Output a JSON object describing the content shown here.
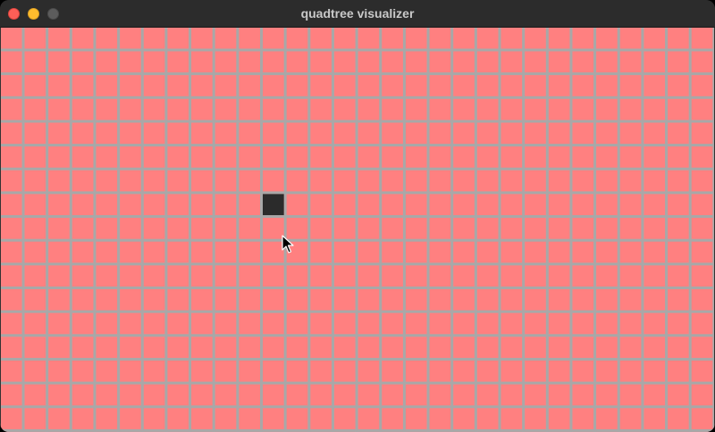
{
  "window": {
    "title": "quadtree visualizer"
  },
  "titlebar": {
    "buttons": [
      {
        "name": "close-button",
        "color": "#fe5f57"
      },
      {
        "name": "minimize-button",
        "color": "#febc2e"
      },
      {
        "name": "zoom-button",
        "color": "#5c5c5c"
      }
    ]
  },
  "canvas": {
    "background_color": "#ff8080",
    "grid_line_color": "#a8a8a8",
    "grid_columns": 30,
    "grid_rows": 17,
    "filled_cells": [
      {
        "col": 11,
        "row": 7,
        "color": "#2b2b2b"
      }
    ]
  },
  "cursor": {
    "icon": "mouse-pointer-icon"
  }
}
